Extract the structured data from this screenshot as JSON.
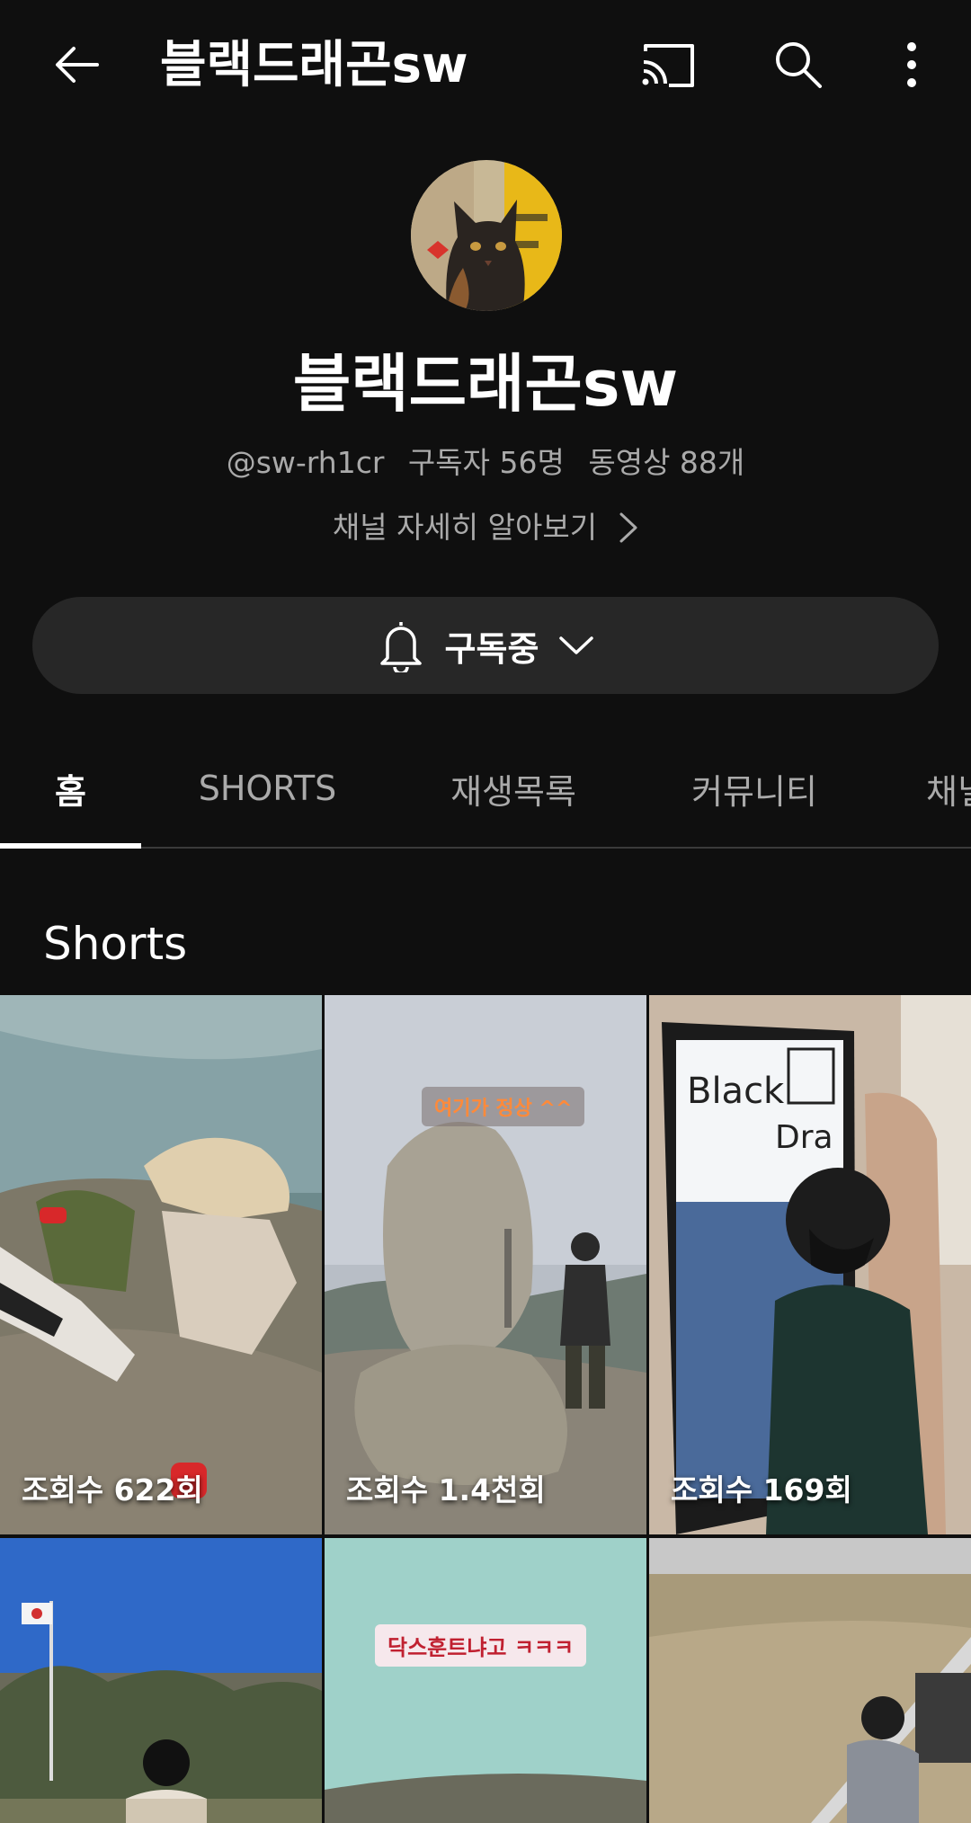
{
  "header": {
    "title": "블랙드래곤sw",
    "back_icon": "arrow-back-icon",
    "cast_icon": "cast-icon",
    "search_icon": "search-icon",
    "more_icon": "more-vert-icon"
  },
  "channel": {
    "name": "블랙드래곤sw",
    "handle": "@sw-rh1cr",
    "subscribers": "구독자 56명",
    "videos": "동영상 88개",
    "more_info": "채널 자세히 알아보기"
  },
  "subscribe": {
    "label": "구독중",
    "bell_icon": "bell-icon",
    "chevron_icon": "chevron-down-icon"
  },
  "tabs": [
    {
      "label": "홈",
      "active": true
    },
    {
      "label": "SHORTS",
      "active": false
    },
    {
      "label": "재생목록",
      "active": false
    },
    {
      "label": "커뮤니티",
      "active": false
    },
    {
      "label": "채널",
      "active": false
    }
  ],
  "shorts": {
    "section_title": "Shorts",
    "items": [
      {
        "views": "조회수 622회"
      },
      {
        "views": "조회수 1.4천회",
        "caption": "여기가 정상 ^^"
      },
      {
        "views": "조회수 169회"
      },
      {
        "views": ""
      },
      {
        "views": "",
        "caption": "닥스훈트냐고 ㅋㅋㅋ"
      },
      {
        "views": ""
      }
    ]
  },
  "colors": {
    "background": "#0f0f0f",
    "secondary_text": "#aaaaaa",
    "pill": "#272727"
  }
}
